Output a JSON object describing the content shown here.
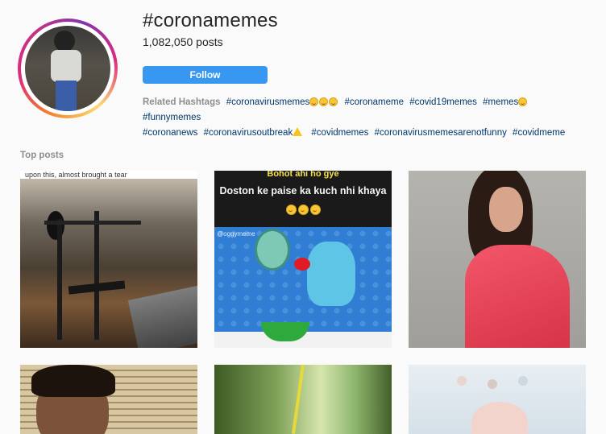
{
  "header": {
    "title": "#coronamemes",
    "posts_count": "1,082,050 posts",
    "follow_label": "Follow"
  },
  "related": {
    "label": "Related Hashtags",
    "tags": [
      "#coronavirusmemes",
      "#coronameme",
      "#covid19memes",
      "#memes",
      "#funnymemes",
      "#coronanews",
      "#coronavirusoutbreak",
      "#covidmemes",
      "#coronavirusmemesarenotfunny",
      "#covidmeme"
    ]
  },
  "top_posts": {
    "label": "Top posts",
    "post1_caption": "upon this, almost brought a tear",
    "post2_line1": "Bohot ahi ho gye",
    "post2_line2": "Doston ke paise ka kuch nhi khaya",
    "post2_handle": "@oggymeme"
  },
  "colors": {
    "follow_button": "#3897f0",
    "hashtag_link": "#00376b",
    "muted_text": "#8e8e8e",
    "background": "#fafafa"
  },
  "icons": [
    "grinning-tears-emoji",
    "warning-emoji"
  ]
}
